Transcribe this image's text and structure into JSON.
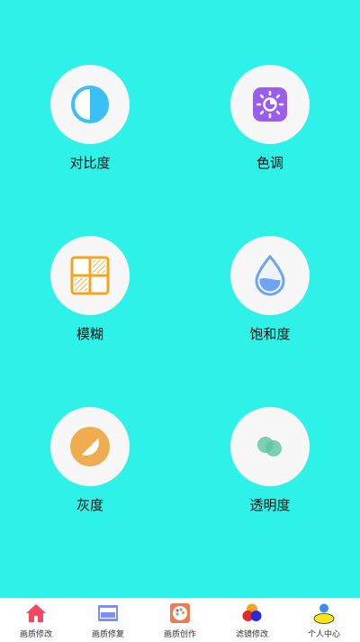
{
  "tools": [
    {
      "label": "对比度",
      "icon": "contrast-icon"
    },
    {
      "label": "色调",
      "icon": "hue-icon"
    },
    {
      "label": "模糊",
      "icon": "blur-icon"
    },
    {
      "label": "饱和度",
      "icon": "saturation-icon"
    },
    {
      "label": "灰度",
      "icon": "grayscale-icon"
    },
    {
      "label": "透明度",
      "icon": "opacity-icon"
    }
  ],
  "tabbar": {
    "items": [
      {
        "label": "画质修改",
        "icon": "home-icon"
      },
      {
        "label": "画质修复",
        "icon": "repair-icon"
      },
      {
        "label": "画质创作",
        "icon": "palette-icon"
      },
      {
        "label": "滤镜修改",
        "icon": "filter-icon"
      },
      {
        "label": "个人中心",
        "icon": "user-icon"
      }
    ]
  },
  "colors": {
    "background": "#2ef2e8",
    "circle": "#f7f7f7",
    "contrast": "#3bbff5",
    "hue": "#9b5cf0",
    "blur": "#f5a51b",
    "saturation": "#6fa4f5",
    "grayscale": "#f0ad50",
    "opacity": "#5dc4a1"
  }
}
